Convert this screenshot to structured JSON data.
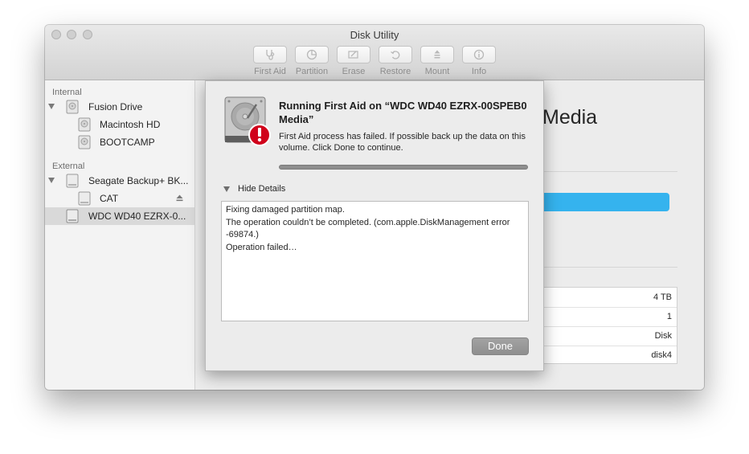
{
  "window": {
    "title": "Disk Utility"
  },
  "toolbar": {
    "items": [
      {
        "label": "First Aid",
        "icon": "stethoscope-icon"
      },
      {
        "label": "Partition",
        "icon": "pie-icon"
      },
      {
        "label": "Erase",
        "icon": "eraser-icon"
      },
      {
        "label": "Restore",
        "icon": "restore-icon"
      },
      {
        "label": "Mount",
        "icon": "mount-icon"
      },
      {
        "label": "Info",
        "icon": "info-icon"
      }
    ]
  },
  "sidebar": {
    "sections": [
      {
        "label": "Internal"
      },
      {
        "label": "External"
      }
    ],
    "items": [
      {
        "label": "Fusion Drive",
        "expanded": true
      },
      {
        "label": "Macintosh HD"
      },
      {
        "label": "BOOTCAMP"
      },
      {
        "label": "Seagate Backup+ BK...",
        "expanded": true
      },
      {
        "label": "CAT",
        "ejectable": true
      },
      {
        "label": "WDC WD40 EZRX-0...",
        "selected": true
      }
    ]
  },
  "main": {
    "title_fragment": "Media",
    "accent_color": "#35b3ee",
    "info_values": [
      "4 TB",
      "1",
      "Disk",
      "disk4"
    ]
  },
  "dialog": {
    "title": "Running First Aid on “WDC WD40 EZRX-00SPEB0 Media”",
    "message": "First Aid process has failed. If possible back up the data on this volume. Click Done to continue.",
    "progress_percent": 100,
    "details_toggle": "Hide Details",
    "log": [
      "Fixing damaged partition map.",
      "The operation couldn’t be completed. (com.apple.DiskManagement error -69874.)",
      "Operation failed…"
    ],
    "done_label": "Done",
    "alert_color": "#d0021b"
  }
}
